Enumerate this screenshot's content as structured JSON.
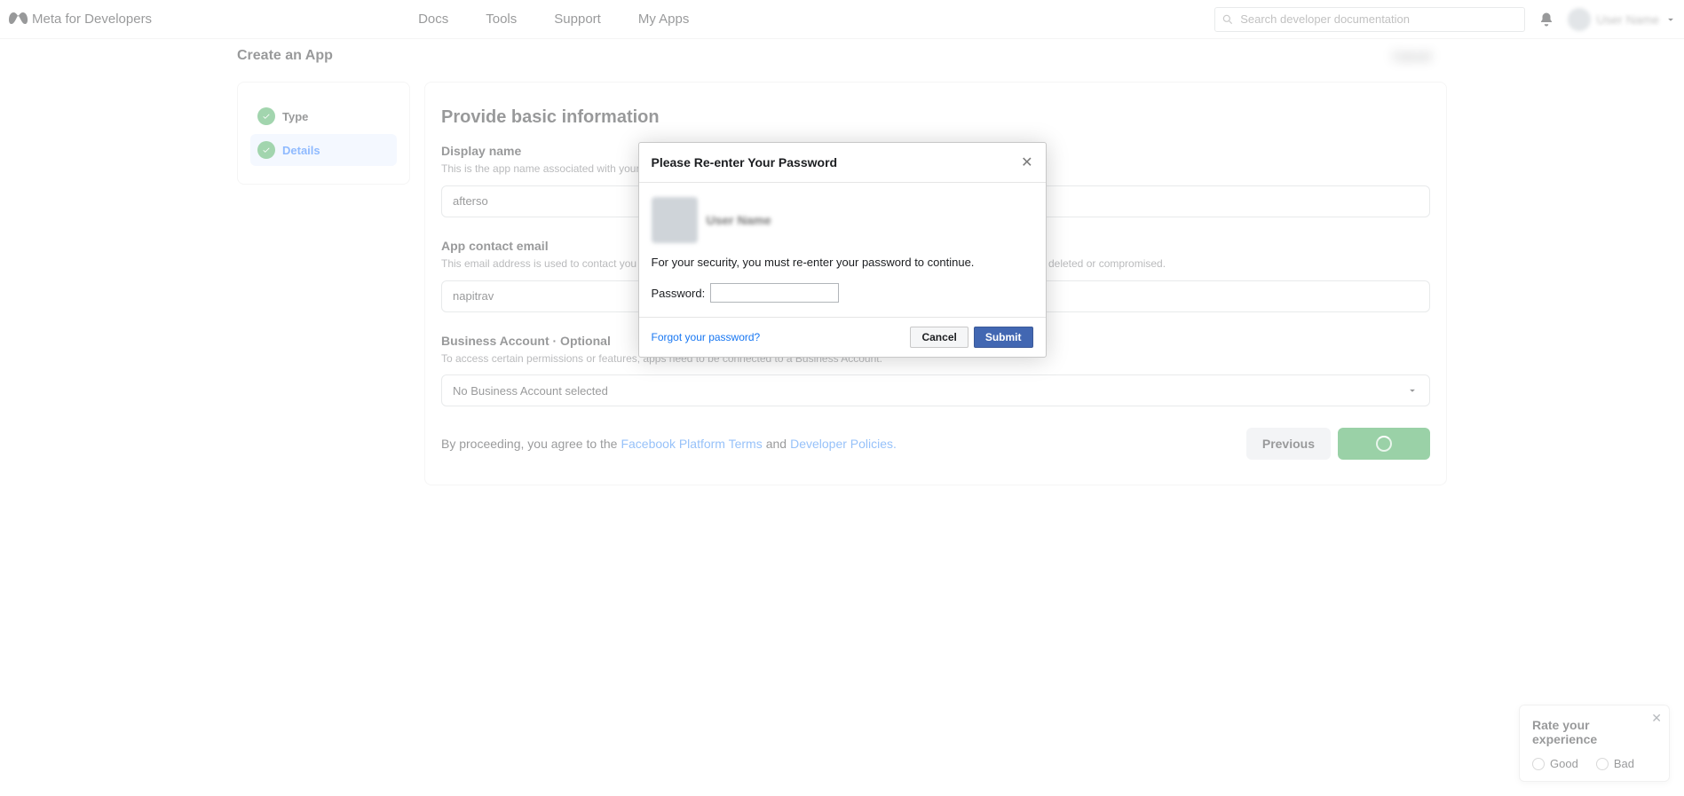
{
  "header": {
    "brand": "Meta for Developers",
    "links": [
      "Docs",
      "Tools",
      "Support",
      "My Apps"
    ],
    "search_placeholder": "Search developer documentation",
    "user_name": "User Name"
  },
  "page": {
    "title": "Create an App",
    "cancel_label": "Cancel"
  },
  "sidebar": {
    "steps": [
      {
        "label": "Type"
      },
      {
        "label": "Details"
      }
    ]
  },
  "main": {
    "heading": "Provide basic information",
    "display_name": {
      "label": "Display name",
      "help": "This is the app name associated with your app ID. You can change this later.",
      "value": "afterso"
    },
    "contact_email": {
      "label": "App contact email",
      "help": "This email address is used to contact you about potential policy violations, app restrictions or steps to recover the app if it's been deleted or compromised.",
      "value": "napitrav"
    },
    "business": {
      "label": "Business Account · Optional",
      "help": "To access certain permissions or features, apps need to be connected to a Business Account.",
      "selected": "No Business Account selected"
    },
    "footer": {
      "prefix": "By proceeding, you agree to the ",
      "terms_link": "Facebook Platform Terms",
      "and": " and ",
      "policies_link": "Developer Policies.",
      "previous_label": "Previous"
    }
  },
  "modal": {
    "title": "Please Re-enter Your Password",
    "user_name": "User Name",
    "body_text": "For your security, you must re-enter your password to continue.",
    "password_label": "Password:",
    "forgot_label": "Forgot your password?",
    "cancel_label": "Cancel",
    "submit_label": "Submit"
  },
  "feedback": {
    "title": "Rate your experience",
    "options": [
      "Good",
      "Bad"
    ]
  }
}
